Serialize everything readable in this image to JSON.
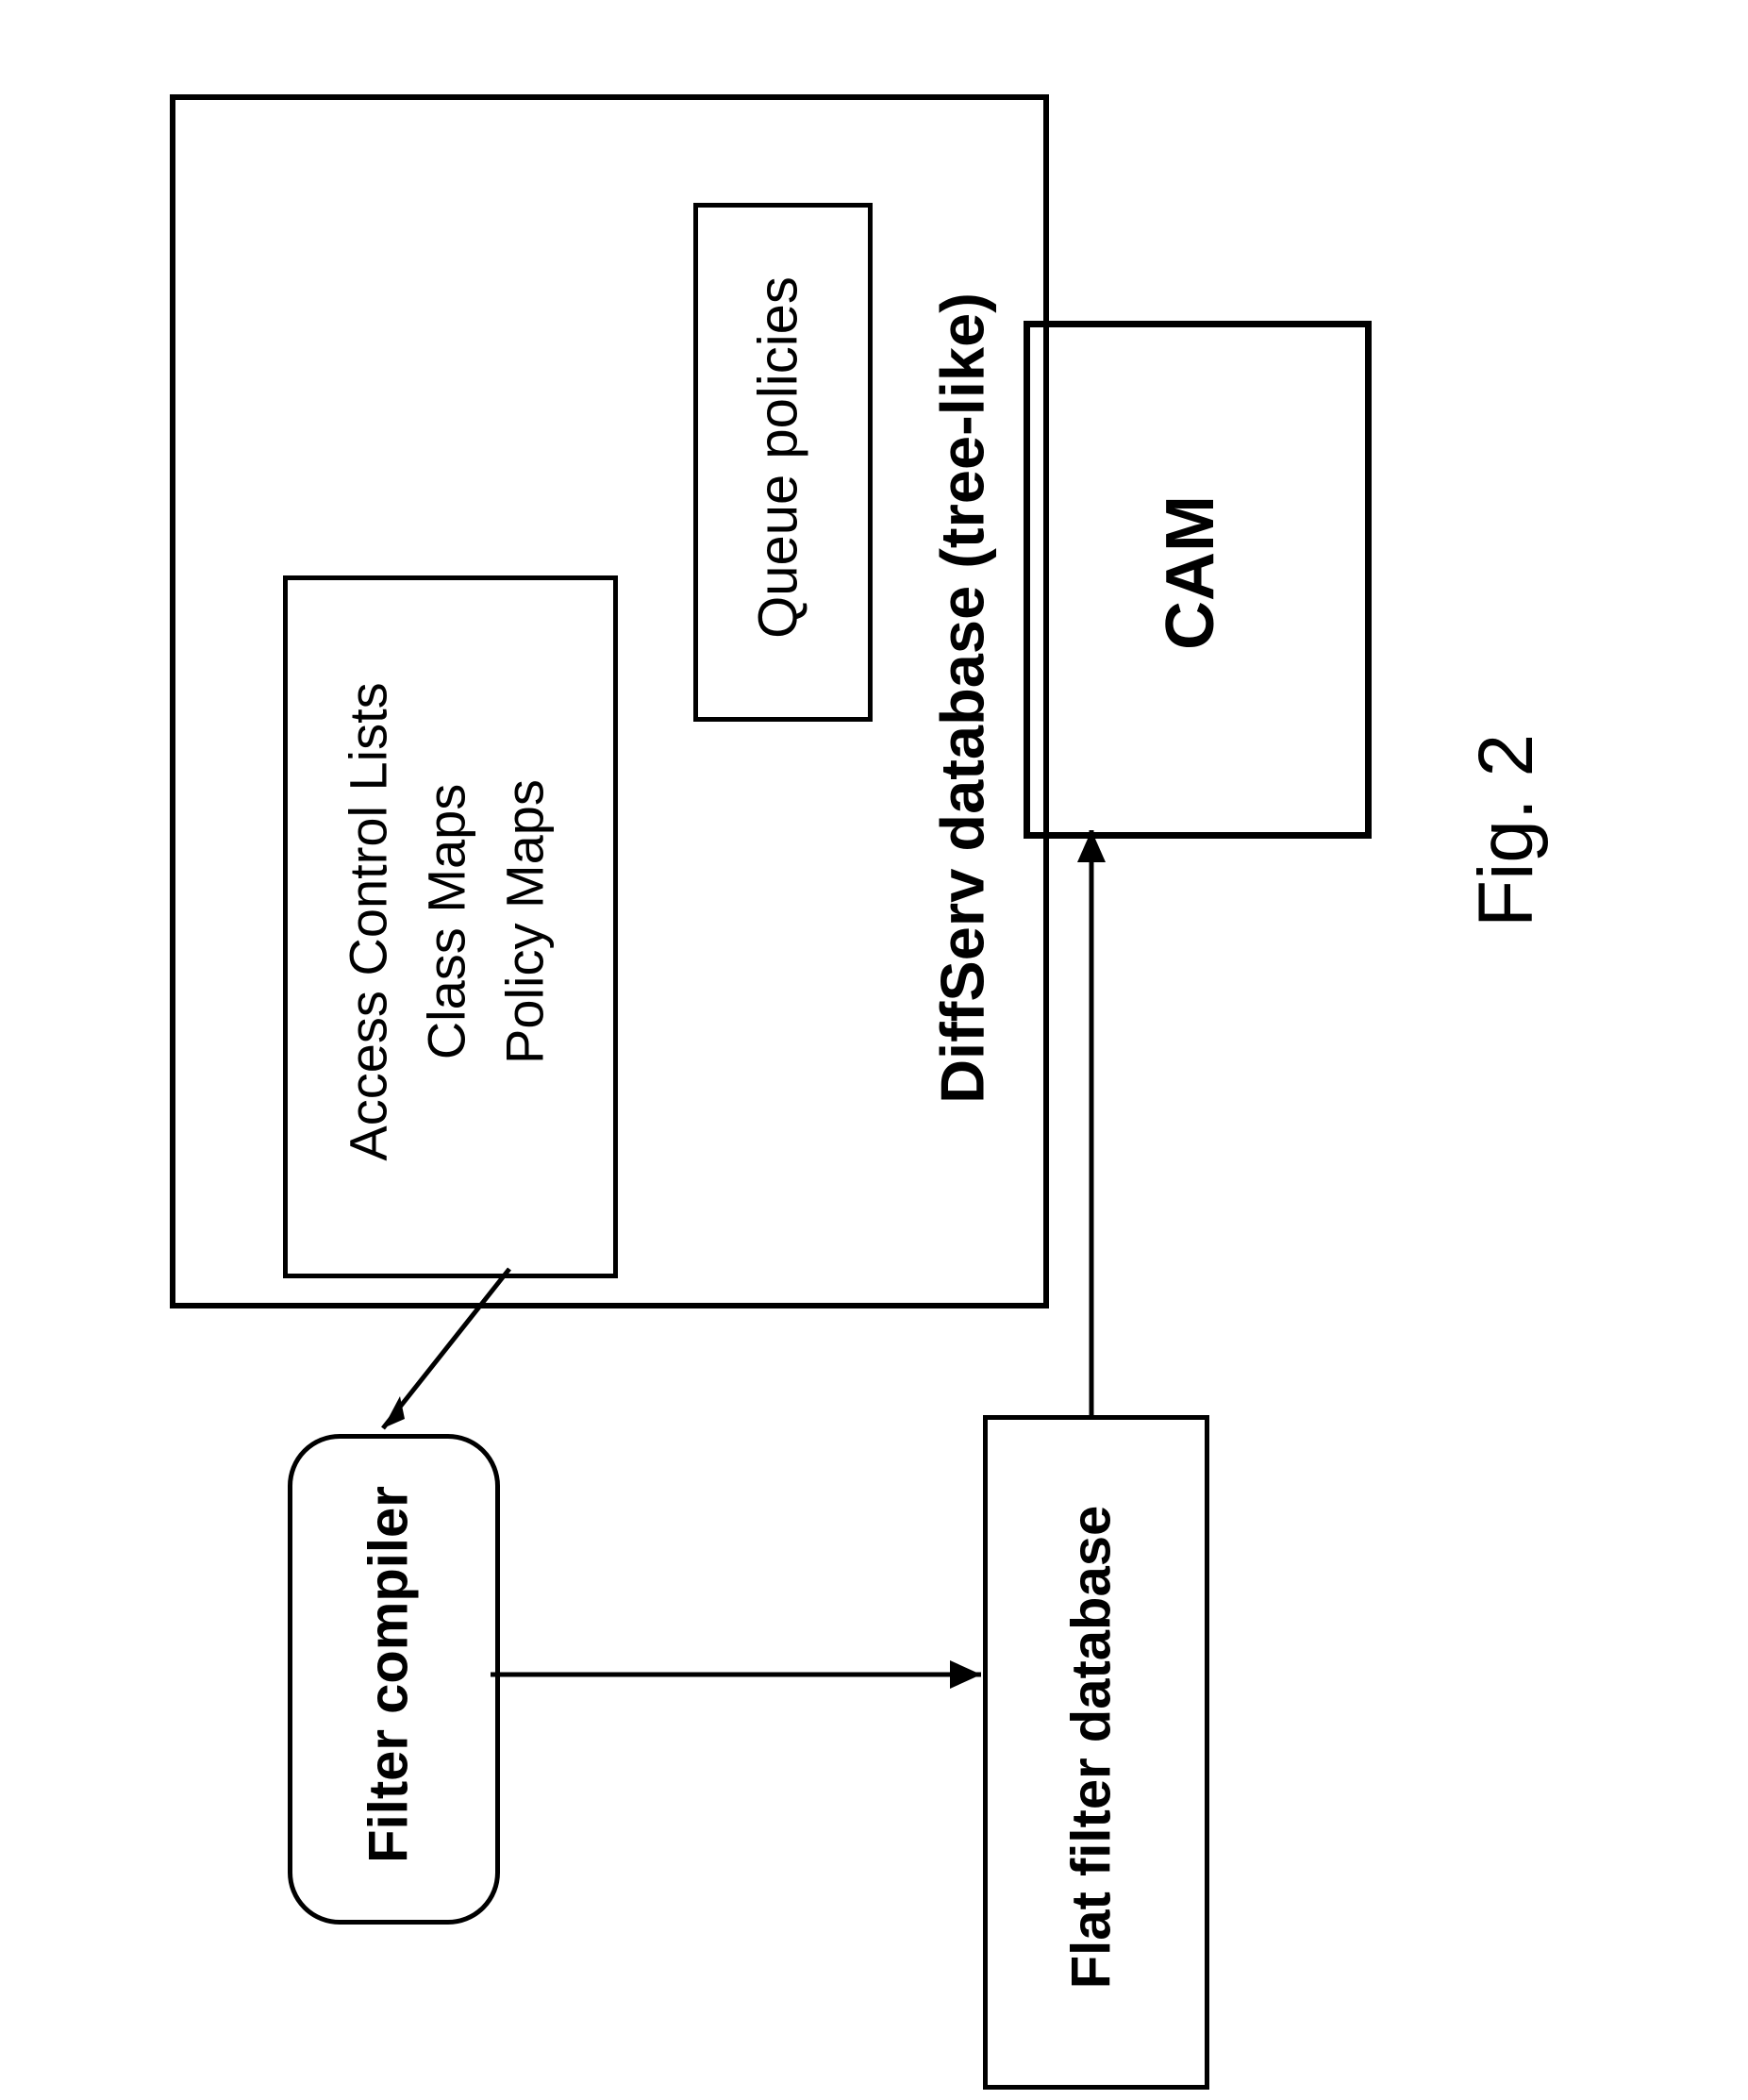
{
  "diffserv": {
    "title": "DiffServ database (tree-like)",
    "box1": {
      "line1": "Access Control Lists",
      "line2": "Class Maps",
      "line3": "Policy Maps"
    },
    "box2": "Queue policies"
  },
  "filter_compiler": "Filter compiler",
  "flat_filter_db": "Flat filter database",
  "cam": "CAM",
  "figure_caption": "Fig. 2"
}
